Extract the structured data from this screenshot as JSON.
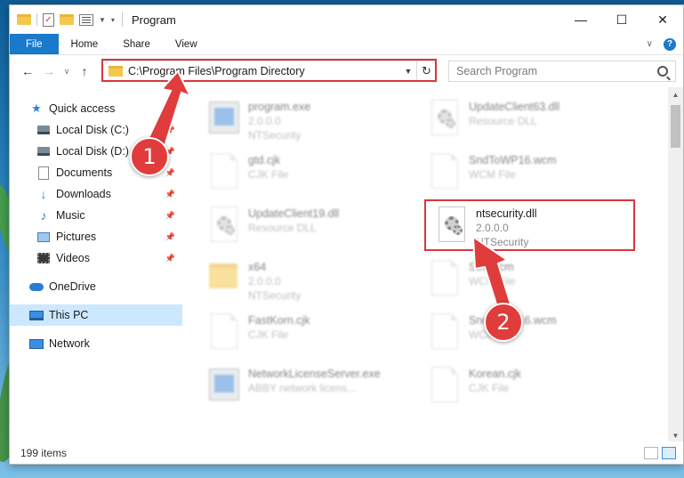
{
  "window": {
    "title": "Program",
    "controls": {
      "minimize": "—",
      "maximize": "☐",
      "close": "✕"
    }
  },
  "ribbon": {
    "tabs": [
      "File",
      "Home",
      "Share",
      "View"
    ],
    "help": "?"
  },
  "navigation": {
    "back": "←",
    "forward": "→",
    "recent": "∨",
    "up": "↑",
    "address": "C:\\Program Files\\Program Directory",
    "refresh": "↻",
    "search_placeholder": "Search Program"
  },
  "sidebar": {
    "items": [
      {
        "label": "Quick access",
        "icon": "star-icon",
        "pinned": false
      },
      {
        "label": "Local Disk (C:)",
        "icon": "drive-icon",
        "pinned": true
      },
      {
        "label": "Local Disk (D:)",
        "icon": "drive-icon",
        "pinned": true
      },
      {
        "label": "Documents",
        "icon": "documents-icon",
        "pinned": true
      },
      {
        "label": "Downloads",
        "icon": "download-icon",
        "pinned": true
      },
      {
        "label": "Music",
        "icon": "music-icon",
        "pinned": true
      },
      {
        "label": "Pictures",
        "icon": "pictures-icon",
        "pinned": true
      },
      {
        "label": "Videos",
        "icon": "videos-icon",
        "pinned": true
      },
      {
        "label": "OneDrive",
        "icon": "cloud-icon",
        "pinned": false
      },
      {
        "label": "This PC",
        "icon": "computer-icon",
        "pinned": false,
        "selected": true
      },
      {
        "label": "Network",
        "icon": "network-icon",
        "pinned": false
      }
    ]
  },
  "files": [
    {
      "name": "program.exe",
      "line1": "2.0.0.0",
      "line2": "NTSecurity",
      "icon": "exe-icon"
    },
    {
      "name": "UpdateClient63.dll",
      "line1": "Resource DLL",
      "line2": "",
      "icon": "dll-icon"
    },
    {
      "name": "gtd.cjk",
      "line1": "CJK File",
      "line2": "",
      "icon": "file-icon"
    },
    {
      "name": "SndToWP16.wcm",
      "line1": "WCM File",
      "line2": "",
      "icon": "file-icon"
    },
    {
      "name": "UpdateClient19.dll",
      "line1": "Resource DLL",
      "line2": "",
      "icon": "dll-icon"
    },
    {
      "name": "ntsecurity.dll",
      "line1": "2.0.0.0",
      "line2": "NTSecurity",
      "icon": "dll-icon",
      "highlighted": true
    },
    {
      "name": "x64",
      "line1": "2.0.0.0",
      "line2": "NTSecurity",
      "icon": "folder-icon"
    },
    {
      "name": "Sec.wcm",
      "line1": "WCM File",
      "line2": "",
      "icon": "file-icon"
    },
    {
      "name": "FastKorn.cjk",
      "line1": "CJK File",
      "line2": "",
      "icon": "file-icon"
    },
    {
      "name": "SndToWP16.wcm",
      "line1": "WCM File",
      "line2": "",
      "icon": "file-icon"
    },
    {
      "name": "NetworkLicenseServer.exe",
      "line1": "ABBY network licens...",
      "line2": "",
      "icon": "exe-icon"
    },
    {
      "name": "Korean.cjk",
      "line1": "CJK File",
      "line2": "",
      "icon": "file-icon"
    }
  ],
  "status": {
    "item_count": "199 items"
  },
  "annotations": {
    "badge1": "1",
    "badge2": "2"
  },
  "colors": {
    "accent": "#1979ca",
    "annotation_red": "#d9363e",
    "selection": "#cce8ff"
  }
}
